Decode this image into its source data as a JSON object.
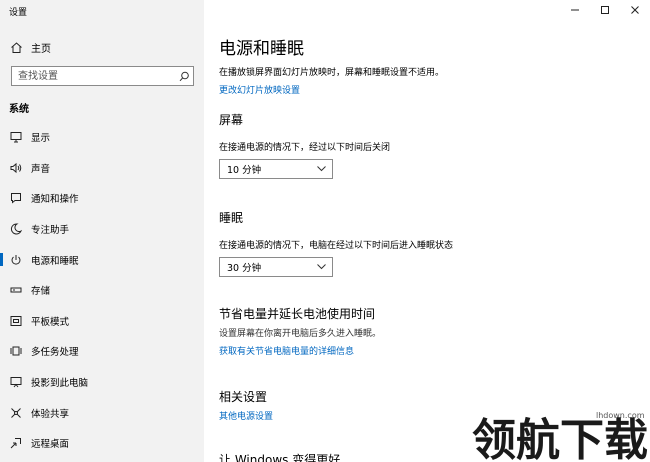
{
  "window": {
    "title": "设置"
  },
  "sidebar": {
    "home_label": "主页",
    "search_placeholder": "查找设置",
    "section": "系统",
    "items": [
      {
        "label": "显示",
        "icon": "monitor-icon"
      },
      {
        "label": "声音",
        "icon": "speaker-icon"
      },
      {
        "label": "通知和操作",
        "icon": "notification-icon"
      },
      {
        "label": "专注助手",
        "icon": "moon-icon"
      },
      {
        "label": "电源和睡眠",
        "icon": "power-icon",
        "active": true
      },
      {
        "label": "存储",
        "icon": "storage-icon"
      },
      {
        "label": "平板模式",
        "icon": "tablet-icon"
      },
      {
        "label": "多任务处理",
        "icon": "multitask-icon"
      },
      {
        "label": "投影到此电脑",
        "icon": "project-icon"
      },
      {
        "label": "体验共享",
        "icon": "share-icon"
      },
      {
        "label": "远程桌面",
        "icon": "remote-desktop-icon"
      }
    ]
  },
  "main": {
    "title": "电源和睡眠",
    "slideshow_note": "在播放锁屏界面幻灯片放映时，屏幕和睡眠设置不适用。",
    "slideshow_link": "更改幻灯片放映设置",
    "screen": {
      "heading": "屏幕",
      "label": "在接通电源的情况下，经过以下时间后关闭",
      "value": "10 分钟"
    },
    "sleep": {
      "heading": "睡眠",
      "label": "在接通电源的情况下，电脑在经过以下时间后进入睡眠状态",
      "value": "30 分钟"
    },
    "battery": {
      "heading": "节省电量并延长电池使用时间",
      "desc": "设置屏幕在你离开电脑后多久进入睡眠。",
      "link": "获取有关节省电脑电量的详细信息"
    },
    "related": {
      "heading": "相关设置",
      "link": "其他电源设置"
    },
    "cut_heading": "让 Windows 变得更好"
  },
  "watermark": {
    "text": "领航下载",
    "url": "lhdown.com"
  }
}
